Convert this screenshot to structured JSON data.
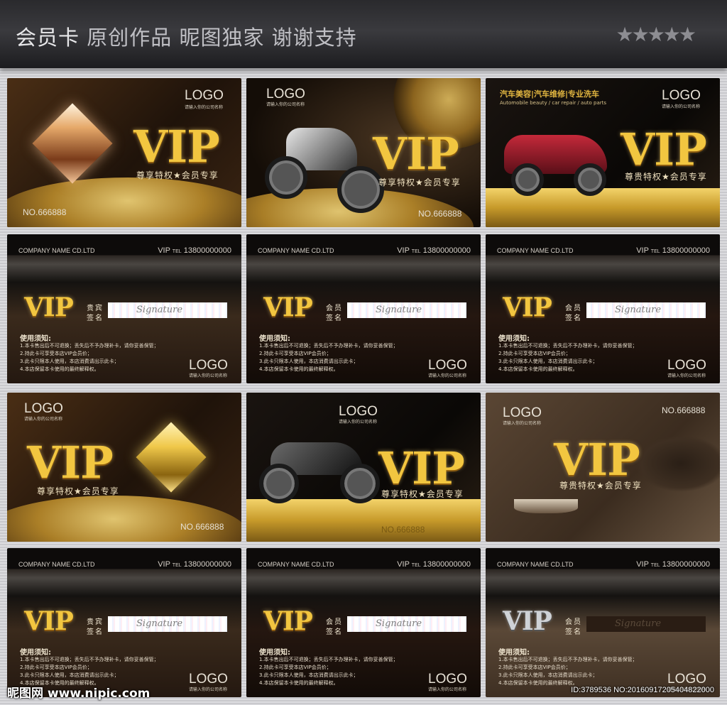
{
  "header": {
    "title_bold": "会员卡",
    "title_rest": "原创作品 昵图独家 谢谢支持",
    "stars": "★★★★★"
  },
  "front_cards": [
    {
      "vip": "VIP",
      "slogan": "尊享特权★会员专享",
      "no": "NO.666888",
      "logo": "LOGO",
      "logo_sub": "请输入你的公司名称"
    },
    {
      "vip": "VIP",
      "slogan": "尊享特权★会员专享",
      "no": "NO.666888",
      "logo": "LOGO",
      "logo_sub": "请输入你的公司名称"
    },
    {
      "vip": "VIP",
      "slogan": "尊贵特权★会员专享",
      "logo": "LOGO",
      "logo_sub": "请输入你的公司名称",
      "banner": "汽车美容|汽车维修|专业洗车",
      "banner_sub": "Automobile beauty / car repair / auto parts"
    },
    {
      "vip": "VIP",
      "slogan": "尊享特权★会员专享",
      "no": "NO.666888",
      "logo": "LOGO",
      "logo_sub": "请输入你的公司名称"
    },
    {
      "vip": "VIP",
      "slogan": "尊享特权★会员专享",
      "no": "NO.666888",
      "logo": "LOGO",
      "logo_sub": "请输入你的公司名称"
    },
    {
      "vip": "VIP",
      "slogan": "尊贵特权★会员专享",
      "no": "NO.666888",
      "logo": "LOGO",
      "logo_sub": "请输入你的公司名称"
    }
  ],
  "back_cards": [
    {
      "company": "COMPANY NAME CD.LTD",
      "vip": "VIP",
      "tel_label": "TEL",
      "tel": "13800000000",
      "label1": "贵宾",
      "label2": "签名",
      "sig": "Signature"
    },
    {
      "company": "COMPANY NAME CD.LTD",
      "vip": "VIP",
      "tel_label": "TEL",
      "tel": "13800000000",
      "label1": "会员",
      "label2": "签名",
      "sig": "Signature"
    },
    {
      "company": "COMPANY NAME CD.LTD",
      "vip": "VIP",
      "tel_label": "TEL",
      "tel": "13800000000",
      "label1": "会员",
      "label2": "签名",
      "sig": "Signature"
    },
    {
      "company": "COMPANY NAME CD.LTD",
      "vip": "VIP",
      "tel_label": "TEL",
      "tel": "13800000000",
      "label1": "贵宾",
      "label2": "签名",
      "sig": "Signature"
    },
    {
      "company": "COMPANY NAME CD.LTD",
      "vip": "VIP",
      "tel_label": "TEL",
      "tel": "13800000000",
      "label1": "会员",
      "label2": "签名",
      "sig": "Signature"
    },
    {
      "company": "COMPANY NAME CD.LTD",
      "vip": "VIP",
      "tel_label": "TEL",
      "tel": "13800000000",
      "label1": "会员",
      "label2": "签名",
      "sig": "Signature"
    }
  ],
  "notice": {
    "title": "使用须知:",
    "lines": [
      "1.本卡售出后不可退换；丢失后不予办理补卡，请你妥善保管；",
      "2.持此卡可享受本店VIP会员价；",
      "3.此卡只限本人使用，本店消费请出示此卡；",
      "4.本店保留本卡使用的最终解释权。"
    ],
    "logo": "LOGO",
    "logo_sub": "请输入你的公司名称"
  },
  "footer": {
    "watermark_left": "昵图网 www.nipic.com",
    "watermark_right": "ID:3789536 NO:20160917205404822000"
  },
  "colors": {
    "gold": "#f2c640",
    "header_bg": "#2a2a2d"
  }
}
